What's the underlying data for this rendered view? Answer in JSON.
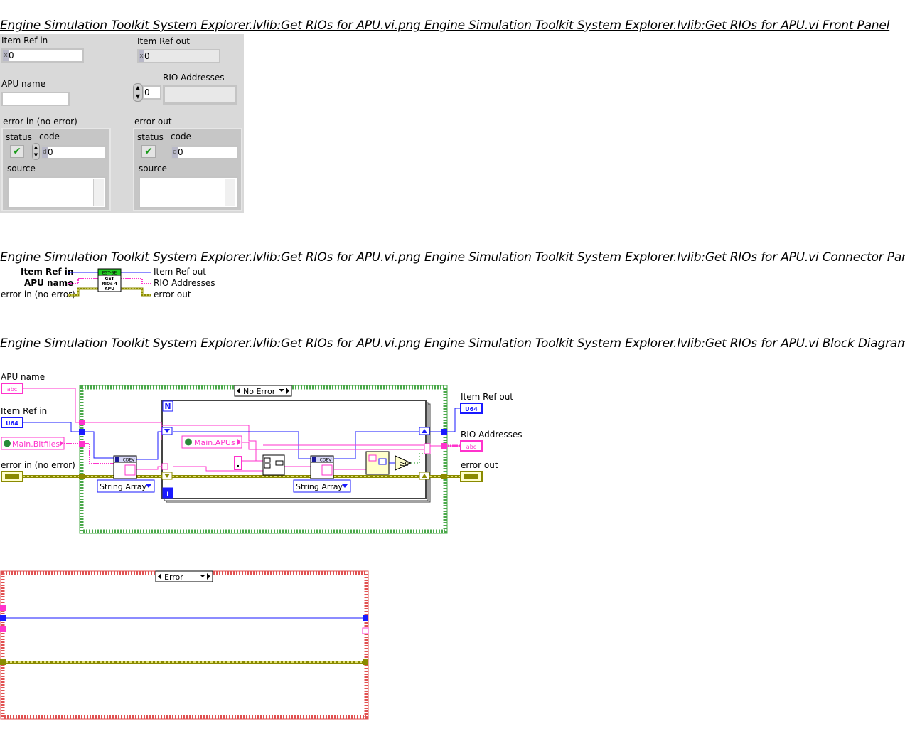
{
  "titles": {
    "front_panel": "Engine Simulation Toolkit System Explorer.lvlib:Get RIOs for APU.vi.png  Engine Simulation Toolkit System Explorer.lvlib:Get RIOs for APU.vi Front Panel",
    "connector_pane": "Engine Simulation Toolkit System Explorer.lvlib:Get RIOs for APU.vi.png  Engine Simulation Toolkit System Explorer.lvlib:Get RIOs for APU.vi Connector Pane",
    "block_diagram": "Engine Simulation Toolkit System Explorer.lvlib:Get RIOs for APU.vi.png  Engine Simulation Toolkit System Explorer.lvlib:Get RIOs for APU.vi Block Diagram"
  },
  "front_panel": {
    "item_ref_in": {
      "label": "Item Ref in",
      "radix": "x",
      "value": "0"
    },
    "item_ref_out": {
      "label": "Item Ref out",
      "radix": "x",
      "value": "0"
    },
    "apu_name": {
      "label": "APU name",
      "value": ""
    },
    "rio_addresses": {
      "label": "RIO Addresses",
      "index": "0"
    },
    "error_in": {
      "label": "error in (no error)",
      "status_label": "status",
      "code_label": "code",
      "code_value": "0",
      "source_label": "source",
      "status_glyph": "✔"
    },
    "error_out": {
      "label": "error out",
      "status_label": "status",
      "code_label": "code",
      "code_value": "0",
      "source_label": "source",
      "status_glyph": "✔"
    }
  },
  "connector_pane": {
    "inputs": [
      "Item Ref in",
      "APU name",
      "error in (no error)"
    ],
    "outputs": [
      "Item Ref out",
      "RIO Addresses",
      "error out"
    ],
    "icon_header": "EST-SE",
    "icon_text": [
      "GET",
      "RIOs 4",
      "APU"
    ]
  },
  "block_diagram": {
    "terminals": {
      "apu_name": "APU name",
      "apu_name_type": "abc",
      "item_ref_in": "Item Ref in",
      "item_ref_in_type": "U64",
      "main_bitfiles": "Main.Bitfiles",
      "error_in": "error in (no error)",
      "item_ref_out": "Item Ref out",
      "item_ref_out_type": "U64",
      "rio_addresses": "RIO Addresses",
      "rio_addresses_type": "abc",
      "error_out": "error out"
    },
    "case_no_error": "No Error",
    "case_error": "Error",
    "main_apus": "Main.APUs",
    "string_array_1": "String Array",
    "string_array_2": "String Array",
    "cdev": "CDEV",
    "loop_n": "N",
    "loop_i": "i",
    "compare": "≥0",
    "colors": {
      "string_wire": "#ff33cc",
      "u64_wire": "#1a1aff",
      "error_wire": "#8a8a00",
      "case_green": "#4aa84a",
      "case_red": "#e05050"
    }
  }
}
